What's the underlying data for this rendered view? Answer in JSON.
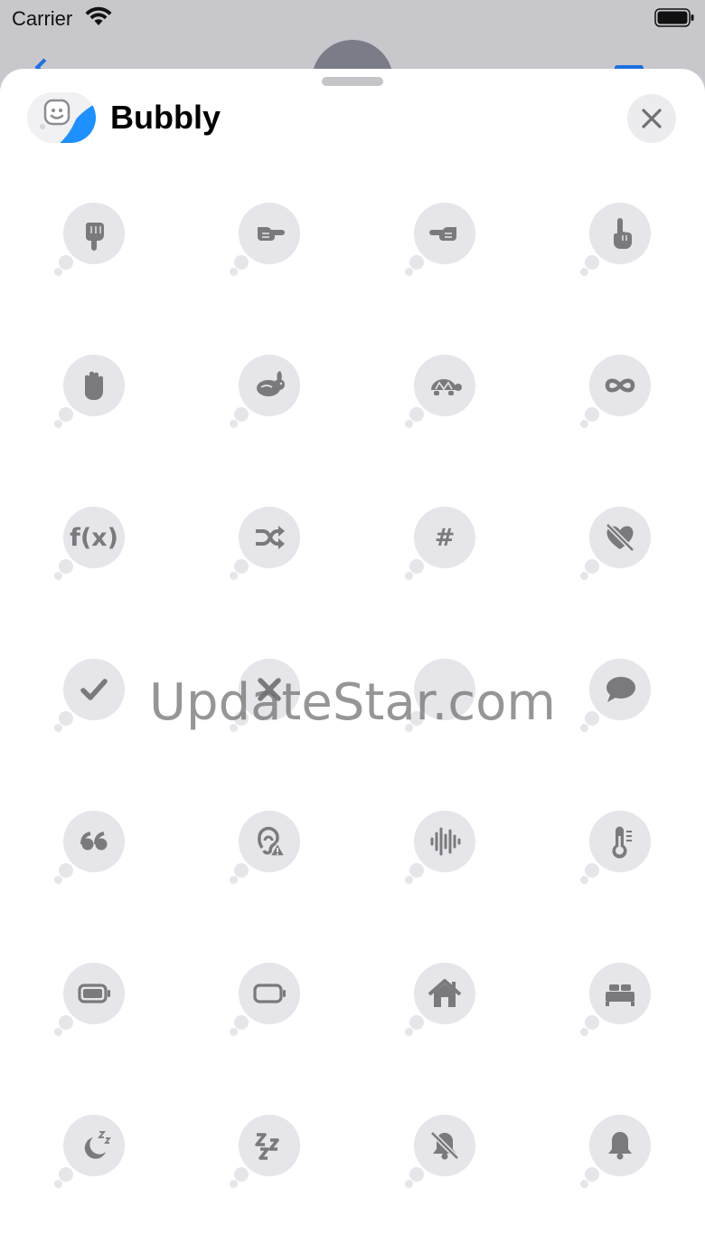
{
  "status_bar": {
    "carrier": "Carrier"
  },
  "app": {
    "title": "Bubbly"
  },
  "watermark": "UpdateStar.com",
  "colors": {
    "glyph": "#7a7a7e",
    "bubble": "#e5e5ea",
    "accent": "#1e90ff"
  },
  "stickers": [
    {
      "icon": "hand-point-down-icon"
    },
    {
      "icon": "hand-point-right-icon"
    },
    {
      "icon": "hand-point-left-icon"
    },
    {
      "icon": "hand-point-up-icon"
    },
    {
      "icon": "hand-raised-icon"
    },
    {
      "icon": "hare-icon"
    },
    {
      "icon": "tortoise-icon"
    },
    {
      "icon": "infinity-icon"
    },
    {
      "icon": "function-icon",
      "text": "f(x)"
    },
    {
      "icon": "shuffle-icon"
    },
    {
      "icon": "number-sign-icon",
      "text": "#"
    },
    {
      "icon": "heart-slash-icon"
    },
    {
      "icon": "checkmark-icon"
    },
    {
      "icon": "xmark-icon"
    },
    {
      "icon": "blank-bubble-icon"
    },
    {
      "icon": "speech-bubble-icon"
    },
    {
      "icon": "quote-icon"
    },
    {
      "icon": "ear-warning-icon"
    },
    {
      "icon": "waveform-icon"
    },
    {
      "icon": "thermometer-icon"
    },
    {
      "icon": "battery-full-icon"
    },
    {
      "icon": "battery-empty-icon"
    },
    {
      "icon": "house-icon"
    },
    {
      "icon": "bed-icon"
    },
    {
      "icon": "moon-zzz-icon"
    },
    {
      "icon": "zzz-icon"
    },
    {
      "icon": "bell-slash-icon"
    },
    {
      "icon": "bell-icon"
    }
  ]
}
